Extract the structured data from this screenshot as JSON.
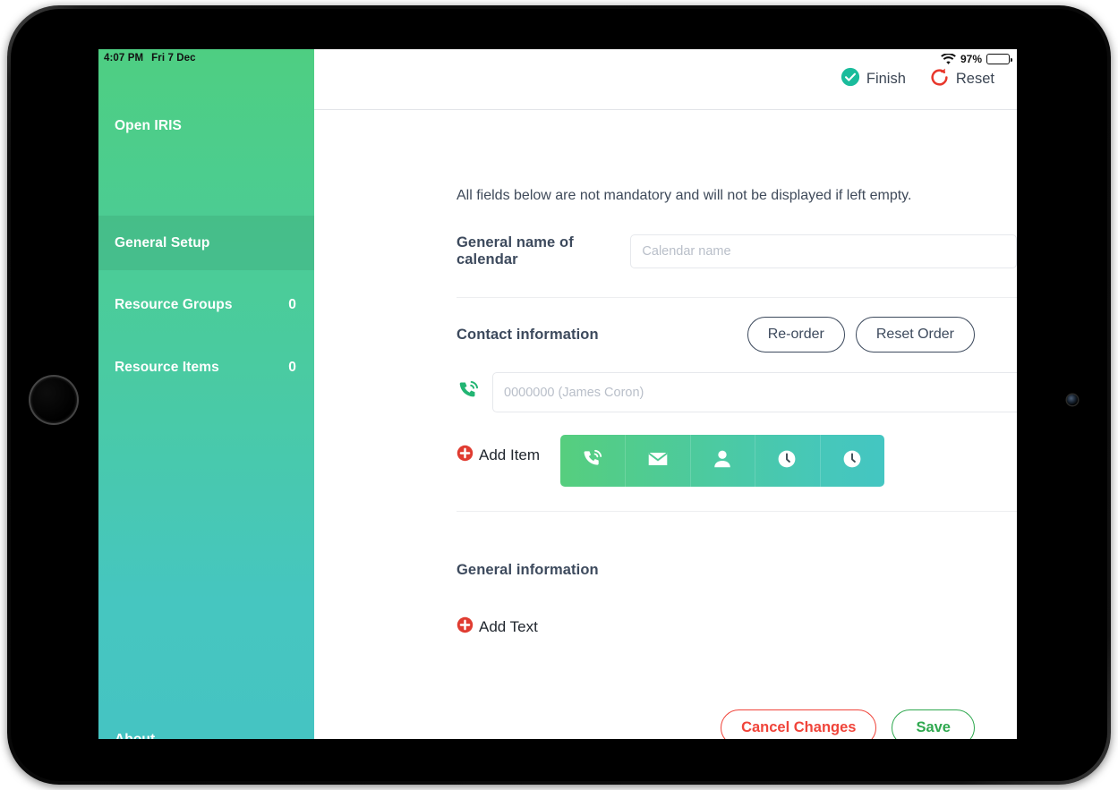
{
  "status_bar": {
    "time": "4:07 PM",
    "date": "Fri 7 Dec",
    "battery_percent": "97%",
    "wifi_icon": "wifi-icon",
    "battery_icon": "battery-icon"
  },
  "sidebar": {
    "items": [
      {
        "label": "Open IRIS",
        "count": "",
        "selected": false
      },
      {
        "label": "General Setup",
        "count": "",
        "selected": true
      },
      {
        "label": "Resource Groups",
        "count": "0",
        "selected": false
      },
      {
        "label": "Resource Items",
        "count": "0",
        "selected": false
      }
    ],
    "about": {
      "label": "About"
    },
    "gradient_start": "#4ECE82",
    "gradient_end": "#45C4C2"
  },
  "topbar": {
    "finish_label": "Finish",
    "finish_icon": "check-circle-icon",
    "finish_color": "#1abc9c",
    "reset_label": "Reset",
    "reset_icon": "refresh-icon",
    "reset_color": "#e8372c"
  },
  "form": {
    "intro_text": "All fields below are not mandatory and will not be displayed if left empty.",
    "calendar_name": {
      "label": "General name of calendar",
      "value": "",
      "placeholder": "Calendar name"
    },
    "contact_section": {
      "title": "Contact information",
      "reorder_label": "Re-order",
      "reset_order_label": "Reset Order",
      "items": [
        {
          "icon": "phone-signal-icon",
          "value": "",
          "placeholder": "0000000 (James Coron)"
        }
      ],
      "add_item_label": "Add Item",
      "add_item_icon": "plus-circle-icon",
      "palette": [
        {
          "icon": "phone-signal-icon",
          "name": "phone"
        },
        {
          "icon": "envelope-icon",
          "name": "email"
        },
        {
          "icon": "person-icon",
          "name": "contact"
        },
        {
          "icon": "clock-icon",
          "name": "hours"
        },
        {
          "icon": "clock-icon",
          "name": "hours-alt"
        }
      ]
    },
    "general_section": {
      "title": "General information",
      "add_text_label": "Add Text",
      "add_text_icon": "plus-circle-icon"
    },
    "footer": {
      "cancel_label": "Cancel Changes",
      "cancel_color": "#f0443a",
      "save_label": "Save",
      "save_color": "#2fa84f"
    }
  }
}
